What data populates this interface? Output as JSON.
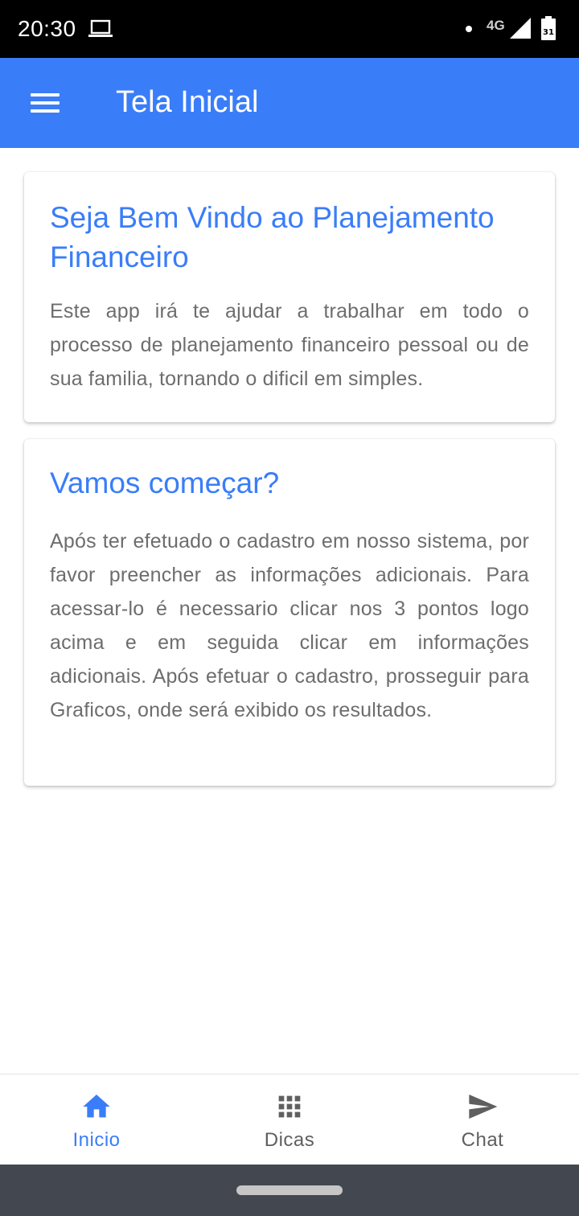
{
  "status_bar": {
    "time": "20:30",
    "network": "4G",
    "battery_level": "31",
    "icons": [
      "laptop-icon",
      "notification-dot-icon",
      "signal-icon",
      "battery-icon"
    ]
  },
  "app_bar": {
    "title": "Tela Inicial",
    "menu_icon": "menu-icon",
    "background_color": "#3a7df8"
  },
  "cards": [
    {
      "title": "Seja Bem Vindo ao Planejamento Financeiro",
      "text": "Este app irá te ajudar a trabalhar em todo o processo de planejamento financeiro pessoal ou de sua familia, tornando o dificil em simples."
    },
    {
      "title": "Vamos começar?",
      "text": "Após ter efetuado o cadastro em nosso sistema, por favor preencher as informações adicionais. Para acessar-lo é necessario clicar nos 3 pontos logo acima e em seguida clicar em informações adicionais. Após efetuar o cadastro, prosseguir para Graficos, onde será exibido os resultados."
    }
  ],
  "bottom_nav": {
    "items": [
      {
        "label": "Inicio",
        "icon": "home-icon",
        "active": true
      },
      {
        "label": "Dicas",
        "icon": "grid-icon",
        "active": false
      },
      {
        "label": "Chat",
        "icon": "send-icon",
        "active": false
      }
    ],
    "active_color": "#3a7df8",
    "inactive_color": "#5f5f5f"
  }
}
